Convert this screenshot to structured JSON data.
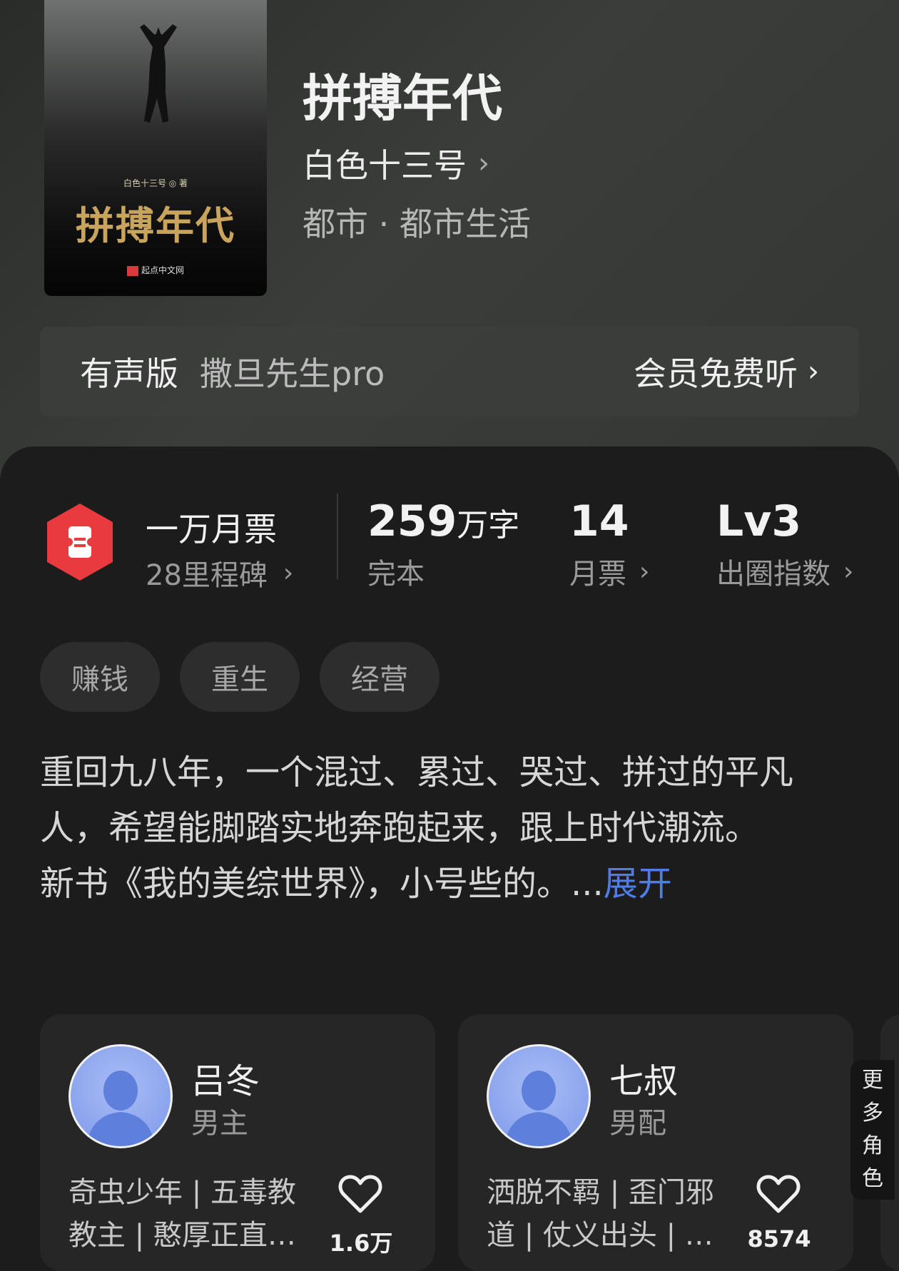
{
  "book": {
    "title": "拼搏年代",
    "author": "白色十三号",
    "genre": "都市 · 都市生活",
    "cover": {
      "author_line": "白色十三号 ◎ 著",
      "title": "拼搏年代",
      "publisher": "起点中文网"
    }
  },
  "audio": {
    "label": "有声版",
    "narrator": "撒旦先生pro",
    "cta": "会员免费听"
  },
  "stats": {
    "ticket_badge": {
      "primary": "一万月票",
      "secondary": "28里程碑"
    },
    "word_count": {
      "value": "259",
      "unit": "万字",
      "label": "完本"
    },
    "monthly_votes": {
      "value": "14",
      "label": "月票"
    },
    "influence": {
      "value": "Lv3",
      "label": "出圈指数"
    }
  },
  "tags": [
    "赚钱",
    "重生",
    "经营"
  ],
  "intro": {
    "line1": "重回九八年，一个混过、累过、哭过、拼过的平凡人，希望能脚踏实地奔跑起来，跟上时代潮流。",
    "line2": "新书《我的美综世界》，小号些的。...",
    "expand": "展开"
  },
  "characters": [
    {
      "name": "吕冬",
      "role": "男主",
      "desc": "奇虫少年 | 五毒教教主 | 憨厚正直…",
      "likes": "1.6万"
    },
    {
      "name": "七叔",
      "role": "男配",
      "desc": "洒脱不羁 | 歪门邪道 | 仗义出头 | …",
      "likes": "8574"
    }
  ],
  "more_roles": [
    "更",
    "多",
    "角",
    "色"
  ],
  "colors": {
    "accent_blue": "#4f7de8",
    "badge_red": "#e83a3f",
    "avatar_blue": "#8aa4ee"
  },
  "icons": {
    "chevron": "chevron-right-icon",
    "heart": "heart-outline-icon",
    "ticket": "ticket-badge-icon"
  }
}
